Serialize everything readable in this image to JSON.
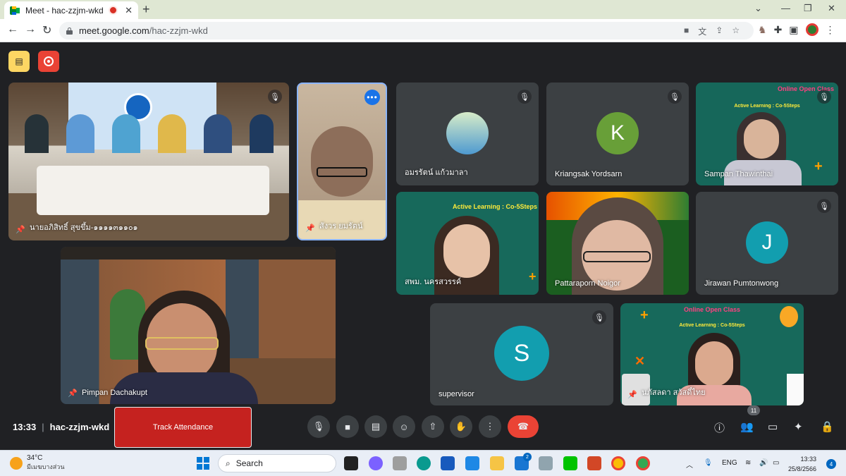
{
  "browser": {
    "tab_title": "Meet - hac-zzjm-wkd",
    "new_tab": "+",
    "url_host": "meet.google.com",
    "url_path": "/hac-zzjm-wkd"
  },
  "meeting": {
    "time": "13:33",
    "code": "hac-zzjm-wkd",
    "track_attendance": "Track Attendance",
    "participants_count": "11"
  },
  "tiles": [
    {
      "name": "นายอภิสิทธิ์ สุขขึ้ม-๑๑๑๑๓๑๑๐๑",
      "type": "video"
    },
    {
      "name": "สังวร ยมรัตน์",
      "type": "video"
    },
    {
      "name": "อมรรัตน์ แก้วมาลา",
      "type": "photo"
    },
    {
      "name": "Kriangsak Yordsarn",
      "type": "avatar",
      "initial": "K",
      "color": "#689f38"
    },
    {
      "name": "Sampan Thawinthai",
      "type": "video"
    },
    {
      "name": "สพม. นครสวรรค์",
      "type": "video"
    },
    {
      "name": "Pattaraporn Noigor",
      "type": "video"
    },
    {
      "name": "Jirawan Pumtonwong",
      "type": "avatar",
      "initial": "J",
      "color": "#129eaf"
    },
    {
      "name": "Pimpan Dachakupt",
      "type": "video"
    },
    {
      "name": "supervisor",
      "type": "avatar",
      "initial": "S",
      "color": "#129eaf"
    },
    {
      "name": "นภัสลดา สวัสดิ์ไทย",
      "type": "video"
    }
  ],
  "slide_text": {
    "online_open_class": "Online Open Class",
    "active_learning": "Active Learning : Co-5Steps"
  },
  "taskbar": {
    "temp": "34°C",
    "weather": "มีเมฆบางส่วน",
    "search": "Search",
    "lang": "ENG",
    "time": "13:33",
    "date": "25/8/2566",
    "notifications": "4",
    "mail_badge": "2"
  }
}
